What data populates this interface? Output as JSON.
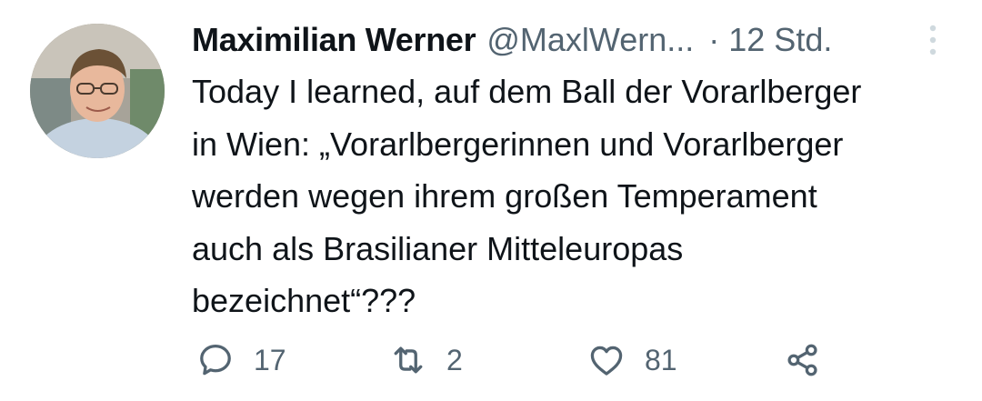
{
  "tweet": {
    "author": {
      "display_name": "Maximilian Werner",
      "handle": "@MaxlWern...",
      "separator": "·",
      "time": "12 Std."
    },
    "text": "Today I learned, auf dem Ball der Vorarlberger\nin Wien: „Vorarlbergerinnen und Vorarlberger\nwerden wegen ihrem großen Temperament\nauch als Brasilianer Mitteleuropas\nbezeichnet“???",
    "actions": {
      "reply_count": "17",
      "retweet_count": "2",
      "like_count": "81"
    }
  },
  "colors": {
    "text_primary": "#0f1419",
    "text_secondary": "#536471",
    "more_dots": "#cfd9de"
  },
  "icons": {
    "more": "more-vertical-icon",
    "reply": "reply-icon",
    "retweet": "retweet-icon",
    "like": "heart-icon",
    "share": "share-icon"
  }
}
